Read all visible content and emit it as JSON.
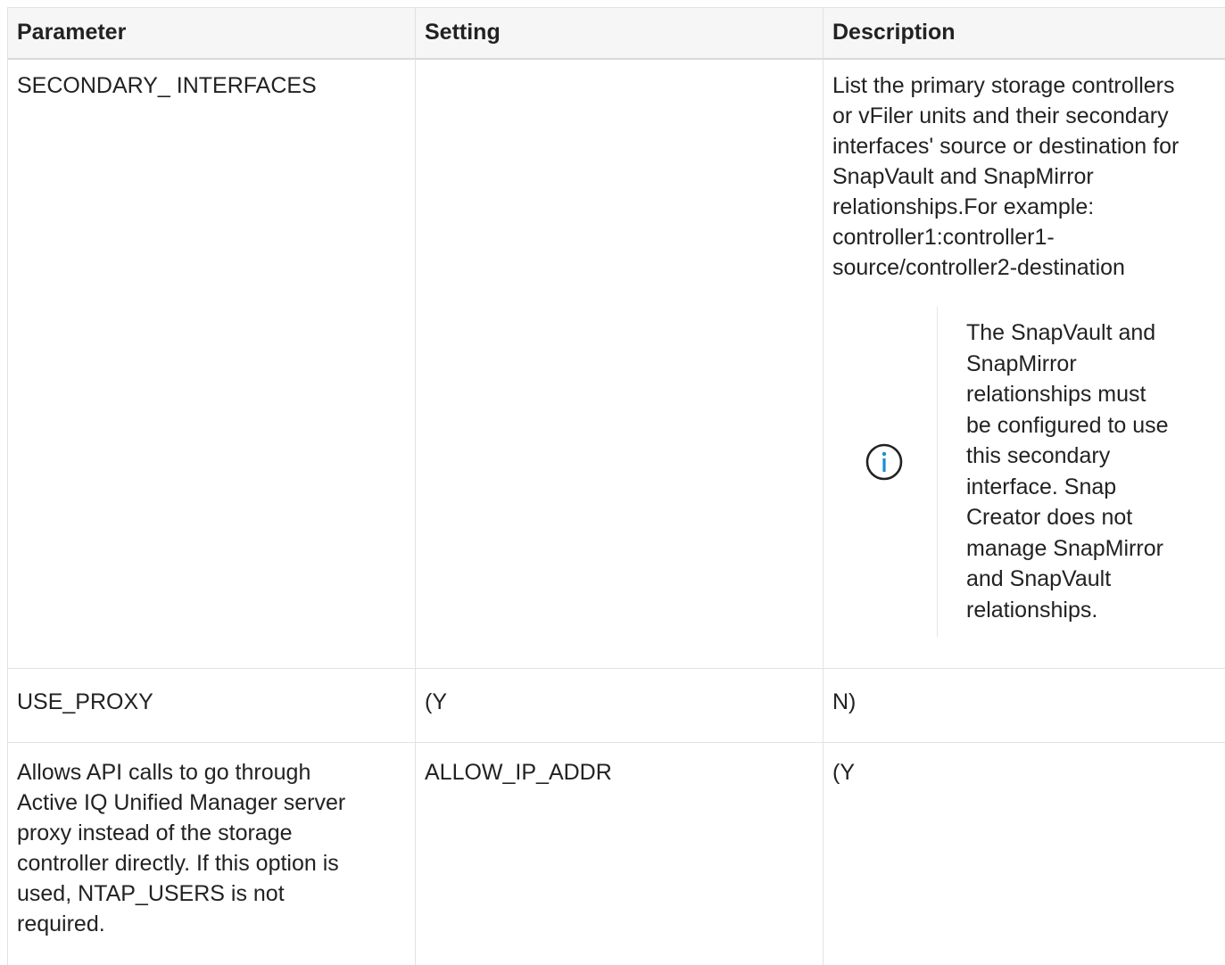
{
  "table": {
    "headers": [
      "Parameter",
      "Setting",
      "Description"
    ],
    "rows": [
      {
        "parameter": "SECONDARY_ INTERFACES",
        "setting": "",
        "description_lines": [
          "List the primary storage controllers",
          "or vFiler units and their secondary",
          "interfaces' source or destination for",
          "SnapVault and SnapMirror",
          "relationships.For example:",
          "controller1:controller1-",
          "source/controller2-destination"
        ],
        "note": {
          "icon": "info-icon",
          "lines": [
            "The SnapVault and",
            "SnapMirror",
            "relationships must",
            "be configured to use",
            "this secondary",
            "interface. Snap",
            "Creator does not",
            "manage SnapMirror",
            "and SnapVault",
            "relationships."
          ]
        }
      },
      {
        "parameter": "USE_PROXY",
        "setting": "(Y",
        "description": "N)"
      },
      {
        "parameter_lines": [
          "Allows API calls to go through",
          "Active IQ Unified Manager server",
          "proxy instead of the storage",
          "controller directly. If this option is",
          "used, NTAP_USERS is not",
          "required."
        ],
        "setting": "ALLOW_IP_ADDR",
        "description": "(Y"
      }
    ]
  },
  "colors": {
    "text": "#222222",
    "header_bg": "#f6f6f6",
    "border": "#e2e2e2",
    "icon": "#1a8cd8"
  }
}
